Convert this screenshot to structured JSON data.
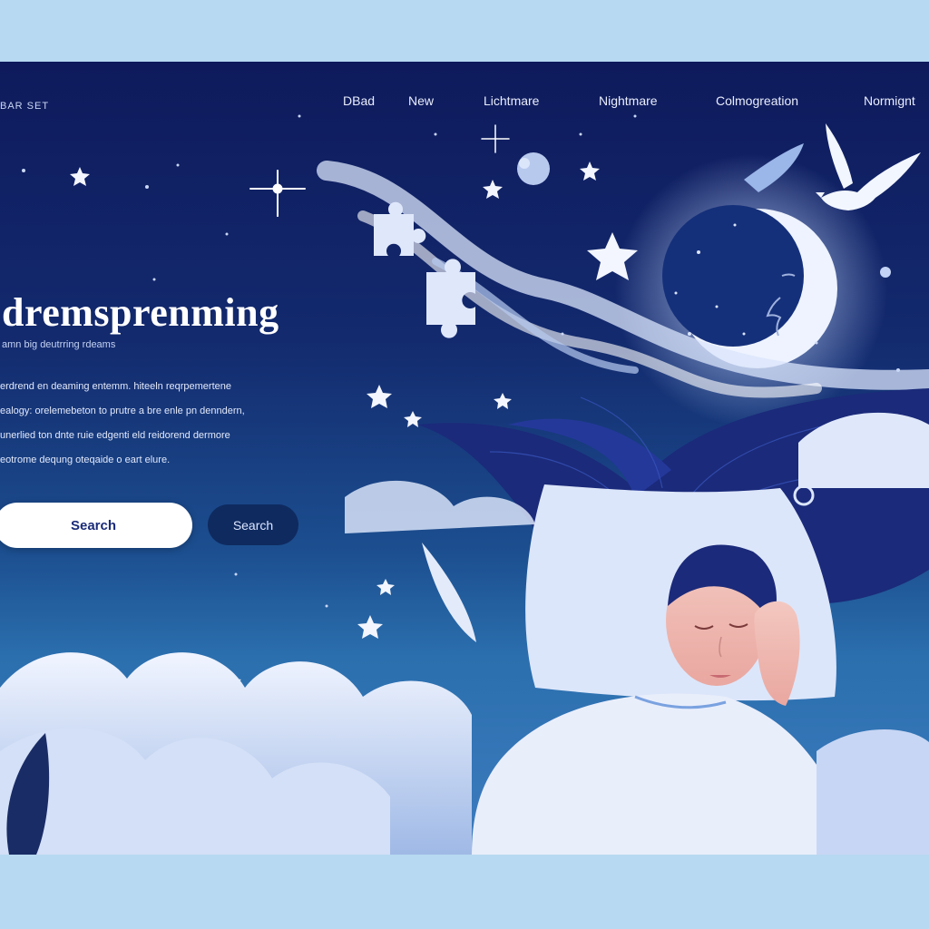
{
  "brand": {
    "text": "BAR SET"
  },
  "nav": {
    "items": [
      {
        "label": "DBad"
      },
      {
        "label": "New"
      },
      {
        "label": "Lichtmare"
      },
      {
        "label": "Nightmare"
      },
      {
        "label": "Colmogreation"
      },
      {
        "label": "Normignt"
      }
    ]
  },
  "hero": {
    "title": "dremsprenming",
    "subtitle": "amn big deutrring rdeams",
    "body": [
      "erdrend en deaming entemm. hiteeln reqrpemertene",
      "ealogy: orelemebeton to prutre a bre enle pn denndern,",
      "unerlied ton dnte ruie edgenti eld reidorend dermore",
      "eotrome dequng oteqaide o eart elure."
    ]
  },
  "search": {
    "input_value": "Search",
    "button_label": "Search"
  },
  "colors": {
    "outer_background": "#b7d9f1",
    "night_sky": "#0e1a5c",
    "accent_button": "#0f2a5f",
    "cloud": "#e4ecfa"
  },
  "illustration": {
    "elements": [
      "moon-face-icon",
      "dove-icon",
      "feather-icon",
      "star-icon",
      "puzzle-piece-icon",
      "planet-icon",
      "sleeping-woman",
      "pillow",
      "clouds"
    ]
  }
}
